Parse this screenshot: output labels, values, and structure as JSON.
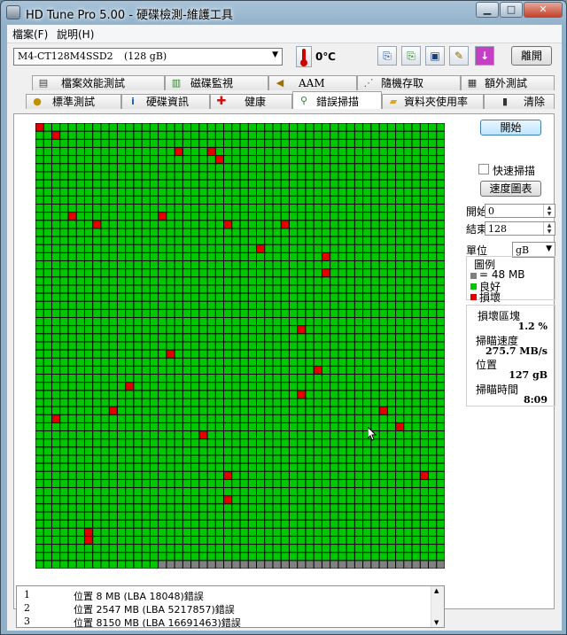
{
  "window": {
    "title": "HD Tune Pro  5.00 - 硬碟檢測-維護工具",
    "controls": [
      "min-icon",
      "max-icon",
      "close-icon"
    ]
  },
  "menu": {
    "file": "檔案(F)",
    "help": "說明(H)"
  },
  "toolbar": {
    "drive": "M4-CT128M4SSD2",
    "capacity": "(128 gB)",
    "temperature": "0℃",
    "exit_label": "離開",
    "icons": [
      "copy-info-icon",
      "copy-screenshot-icon",
      "save-icon",
      "options-icon",
      "download-icon"
    ]
  },
  "tabs_top": [
    {
      "label": "檔案效能測試",
      "icon": "file-benchmark-icon"
    },
    {
      "label": "磁碟監視",
      "icon": "disk-monitor-icon"
    },
    {
      "label": "AAM",
      "icon": "speaker-icon"
    },
    {
      "label": "隨機存取",
      "icon": "random-access-icon"
    },
    {
      "label": "額外測試",
      "icon": "extra-tests-icon"
    }
  ],
  "tabs_bottom": [
    {
      "label": "標準測試",
      "icon": "benchmark-icon"
    },
    {
      "label": "硬碟資訊",
      "icon": "info-icon"
    },
    {
      "label": "健康",
      "icon": "health-cross-icon"
    },
    {
      "label": "錯誤掃描",
      "icon": "magnifier-icon",
      "active": true
    },
    {
      "label": "資料夾使用率",
      "icon": "folder-icon"
    },
    {
      "label": "清除",
      "icon": "trash-icon"
    }
  ],
  "controls": {
    "start_label": "開始",
    "quick_scan_label": "快速掃描",
    "quick_scan_checked": false,
    "speed_map_label": "速度圖表",
    "start_field_label": "開始",
    "start_value": "0",
    "end_field_label": "結束",
    "end_value": "128",
    "unit_label": "單位",
    "unit_value": "gB"
  },
  "legend": {
    "title": "圖例",
    "block_size": "= 48 MB",
    "good": "良好",
    "damaged": "損壞",
    "colors": {
      "unscanned": "#808080",
      "good": "#00c800",
      "damaged": "#e00000"
    }
  },
  "stats": {
    "damaged_blocks_label": "損壞區塊",
    "damaged_blocks": "1.2 %",
    "scan_speed_label": "掃瞄速度",
    "scan_speed": "275.7 MB/s",
    "position_label": "位置",
    "position": "127 gB",
    "scan_time_label": "掃瞄時間",
    "scan_time": "8:09"
  },
  "block_grid": {
    "columns": 50,
    "rows": 55,
    "unscanned_from_index": 2715,
    "bad_blocks": [
      [
        0,
        0
      ],
      [
        2,
        1
      ],
      [
        17,
        3
      ],
      [
        21,
        3
      ],
      [
        22,
        4
      ],
      [
        4,
        11
      ],
      [
        15,
        11
      ],
      [
        7,
        12
      ],
      [
        23,
        12
      ],
      [
        30,
        12
      ],
      [
        27,
        15
      ],
      [
        35,
        16
      ],
      [
        35,
        18
      ],
      [
        32,
        25
      ],
      [
        16,
        28
      ],
      [
        34,
        30
      ],
      [
        11,
        32
      ],
      [
        32,
        33
      ],
      [
        9,
        35
      ],
      [
        42,
        35
      ],
      [
        2,
        36
      ],
      [
        44,
        37
      ],
      [
        20,
        38
      ],
      [
        47,
        43
      ],
      [
        23,
        43
      ],
      [
        23,
        46
      ],
      [
        6,
        50
      ],
      [
        6,
        51
      ]
    ]
  },
  "log": [
    {
      "n": "1",
      "msg": "位置 8 MB (LBA 18048)錯誤"
    },
    {
      "n": "2",
      "msg": "位置 2547 MB (LBA 5217857)錯誤"
    },
    {
      "n": "3",
      "msg": "位置 8150 MB (LBA 16691463)錯誤"
    }
  ]
}
